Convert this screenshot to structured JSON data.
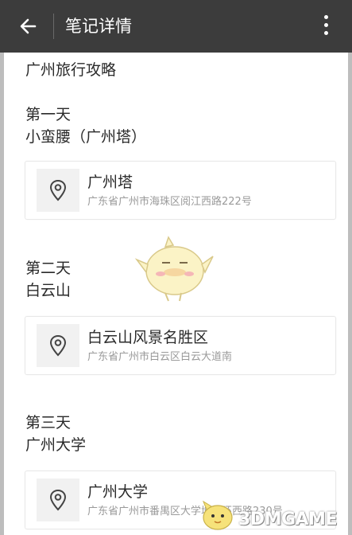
{
  "header": {
    "title": "笔记详情",
    "back_icon": "arrow-left-icon",
    "more_icon": "more-vertical-icon"
  },
  "note": {
    "title": "广州旅行攻略",
    "days": [
      {
        "day_label": "第一天",
        "subtitle": "小蛮腰（广州塔）",
        "place": {
          "name": "广州塔",
          "address": "广东省广州市海珠区阅江西路222号",
          "icon": "location-pin-icon"
        }
      },
      {
        "day_label": "第二天",
        "subtitle": "白云山",
        "place": {
          "name": "白云山风景名胜区",
          "address": "广东省广州市白云区白云大道南",
          "icon": "location-pin-icon"
        }
      },
      {
        "day_label": "第三天",
        "subtitle": "广州大学",
        "place": {
          "name": "广州大学",
          "address": "广东省广州市番禺区大学城外环西路230号",
          "icon": "location-pin-icon"
        }
      }
    ]
  },
  "watermark": {
    "text": "3DMGAME"
  },
  "colors": {
    "topbar": "#3c3c3c",
    "text": "#2b2b2b",
    "address": "#9a9a9a",
    "card_icon_bg": "#f1f1f1"
  }
}
